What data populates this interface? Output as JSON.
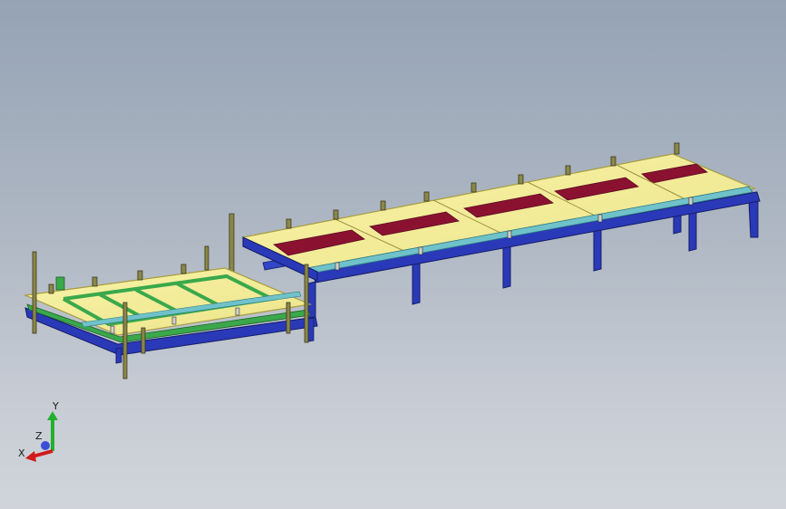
{
  "triad": {
    "x_label": "X",
    "y_label": "Y",
    "z_label": "Z",
    "x_color": "#d11a1a",
    "y_color": "#23b02f",
    "z_color": "#3b4fd6"
  },
  "colors": {
    "table_top": "#f4ee9a",
    "table_top_edge": "#b7ad4f",
    "frame_blue": "#2a39b8",
    "frame_dark": "#1a247c",
    "rail_green": "#3aa84b",
    "slot_red": "#8a1230",
    "rail_teal": "#6fc2c9"
  }
}
